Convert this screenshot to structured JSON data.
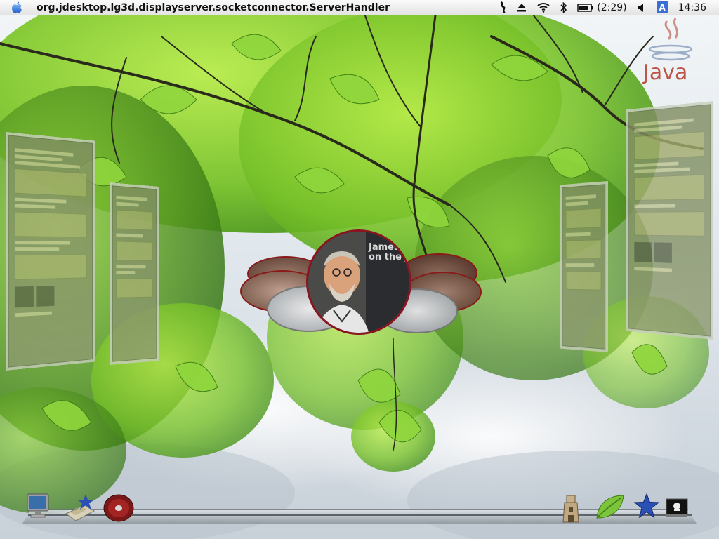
{
  "menubar": {
    "app_title": "org.jdesktop.lg3d.displayserver.socketconnector.ServerHandler",
    "battery": "(2:29)",
    "input_method": "A",
    "clock": "14:36",
    "icons": [
      "apple-icon",
      "script-icon",
      "eject-icon",
      "wifi-icon",
      "bluetooth-icon",
      "battery-icon",
      "volume-icon",
      "input-method-icon"
    ]
  },
  "desktop": {
    "logo_text": "Java",
    "photo_caption": "James Go on the Ja",
    "colors": {
      "sky": "#e6ecf2",
      "leaf": "#6fb52c",
      "frame": "#8a1520"
    }
  },
  "dock": {
    "items": [
      "monitor-icon",
      "preferences-icon",
      "cd-icon",
      "tower-icon",
      "leaf-icon",
      "star-icon",
      "terminal-icon"
    ]
  }
}
